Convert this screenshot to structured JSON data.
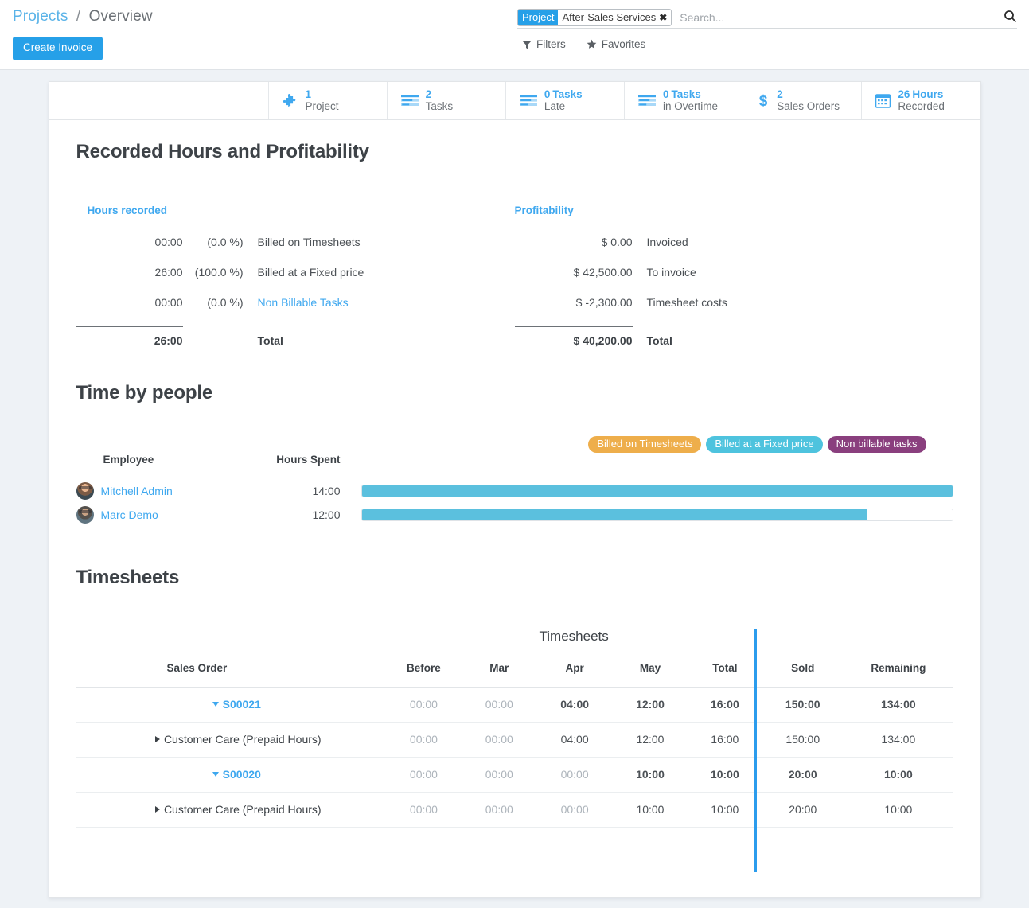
{
  "breadcrumb": {
    "root": "Projects",
    "separator": "/",
    "current": "Overview"
  },
  "toolbar": {
    "create_invoice_label": "Create Invoice"
  },
  "search": {
    "facet_label": "Project",
    "facet_value": "After-Sales Services",
    "facet_remove_icon": "close-icon",
    "placeholder": "Search...",
    "search_icon": "search-icon",
    "filters_label": "Filters",
    "filters_icon": "filter-icon",
    "favorites_label": "Favorites",
    "favorites_icon": "star-icon"
  },
  "stat_buttons": [
    {
      "value": "1",
      "unit": "",
      "sub": "Project",
      "icon": "puzzle-icon"
    },
    {
      "value": "2",
      "unit": "",
      "sub": "Tasks",
      "icon": "list-icon"
    },
    {
      "value": "0",
      "unit": "Tasks",
      "sub": "Late",
      "icon": "list-icon"
    },
    {
      "value": "0",
      "unit": "Tasks",
      "sub": "in Overtime",
      "icon": "list-icon"
    },
    {
      "value": "2",
      "unit": "",
      "sub": "Sales Orders",
      "icon": "dollar-icon"
    },
    {
      "value": "26",
      "unit": "Hours",
      "sub": "Recorded",
      "icon": "calendar-icon"
    }
  ],
  "profitability_section": {
    "title": "Recorded Hours and Profitability",
    "hours": {
      "heading": "Hours recorded",
      "rows": [
        {
          "value": "00:00",
          "pct": "(0.0 %)",
          "label": "Billed on Timesheets",
          "link": false
        },
        {
          "value": "26:00",
          "pct": "(100.0 %)",
          "label": "Billed at a Fixed price",
          "link": false
        },
        {
          "value": "00:00",
          "pct": "(0.0 %)",
          "label": "Non Billable Tasks",
          "link": true
        }
      ],
      "total": {
        "value": "26:00",
        "label": "Total"
      }
    },
    "profit": {
      "heading": "Profitability",
      "rows": [
        {
          "value": "$ 0.00",
          "label": "Invoiced"
        },
        {
          "value": "$ 42,500.00",
          "label": "To invoice"
        },
        {
          "value": "$ -2,300.00",
          "label": "Timesheet costs"
        }
      ],
      "total": {
        "value": "$ 40,200.00",
        "label": "Total"
      }
    }
  },
  "time_by_people": {
    "title": "Time by people",
    "legend": [
      {
        "label": "Billed on Timesheets",
        "color": "#eeae4b"
      },
      {
        "label": "Billed at a Fixed price",
        "color": "#4ec3de"
      },
      {
        "label": "Non billable tasks",
        "color": "#8a3f7e"
      }
    ],
    "columns": {
      "employee": "Employee",
      "hours": "Hours Spent"
    },
    "rows": [
      {
        "name": "Mitchell Admin",
        "hours": "14:00",
        "bar_pct": 100,
        "bar_color": "#5bc0de",
        "avatar": "avatar-mitchell"
      },
      {
        "name": "Marc Demo",
        "hours": "12:00",
        "bar_pct": 85.7,
        "bar_color": "#5bc0de",
        "avatar": "avatar-marc"
      }
    ]
  },
  "timesheets": {
    "title": "Timesheets",
    "group_header": "Timesheets",
    "columns": [
      "Sales Order",
      "Before",
      "Mar",
      "Apr",
      "May",
      "Total",
      "Sold",
      "Remaining"
    ],
    "rows": [
      {
        "type": "group",
        "name": "S00021",
        "caret": "caret-down-icon",
        "cells": [
          "00:00",
          "00:00",
          "04:00",
          "12:00",
          "16:00",
          "150:00",
          "134:00"
        ]
      },
      {
        "type": "child",
        "name": "Customer Care (Prepaid Hours)",
        "caret": "caret-right-icon",
        "cells": [
          "00:00",
          "00:00",
          "04:00",
          "12:00",
          "16:00",
          "150:00",
          "134:00"
        ]
      },
      {
        "type": "group",
        "name": "S00020",
        "caret": "caret-down-icon",
        "cells": [
          "00:00",
          "00:00",
          "00:00",
          "10:00",
          "10:00",
          "20:00",
          "10:00"
        ]
      },
      {
        "type": "child",
        "name": "Customer Care (Prepaid Hours)",
        "caret": "caret-right-icon",
        "cells": [
          "00:00",
          "00:00",
          "00:00",
          "10:00",
          "10:00",
          "20:00",
          "10:00"
        ]
      }
    ]
  },
  "colors": {
    "accent": "#26a0e8",
    "link": "#3fa8ef",
    "bar": "#5bc0de",
    "divider": "#2b9ced",
    "page_bg": "#eef2f6"
  }
}
